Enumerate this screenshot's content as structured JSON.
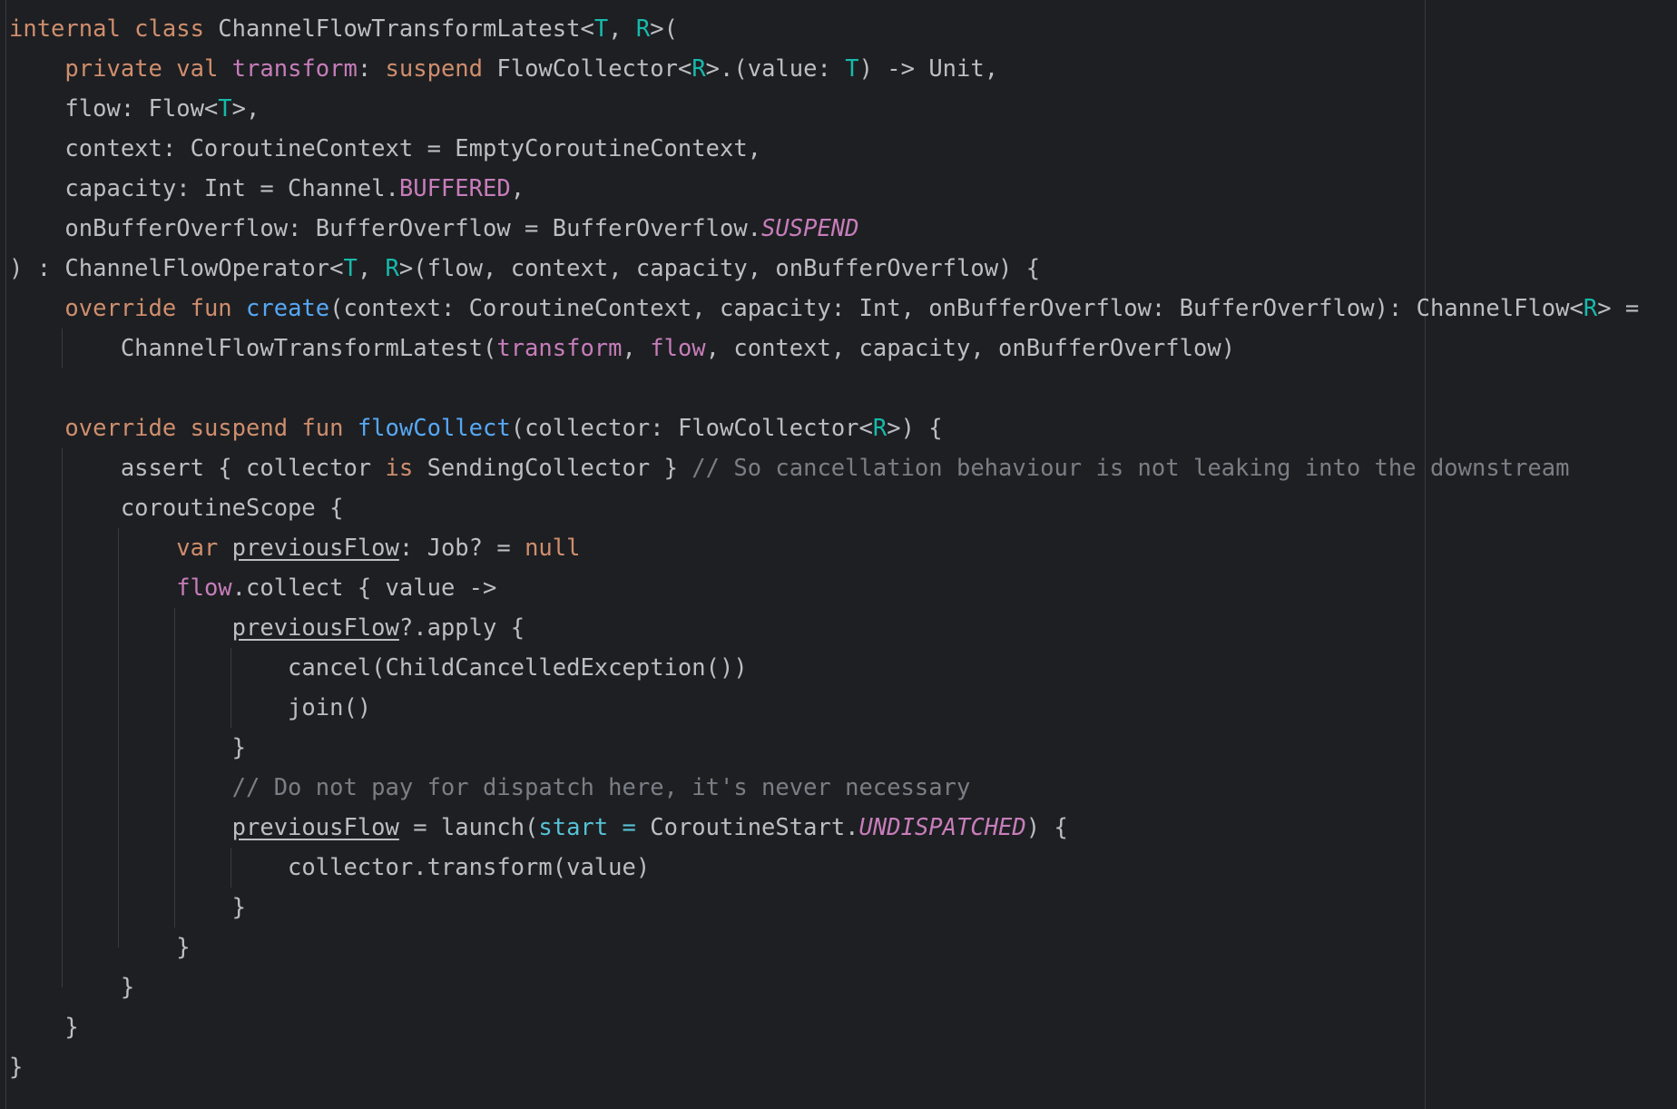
{
  "editor": {
    "theme": {
      "background": "#1e1f22",
      "default_text": "#bcbec4",
      "keyword": "#cf8e6d",
      "type_parameter": "#16baac",
      "property": "#c77dbb",
      "function_declaration": "#56a8f5",
      "comment": "#7a7e85",
      "named_argument": "#56c1d6",
      "guide": "#393b40"
    },
    "lines": [
      [
        [
          "kw",
          "internal class "
        ],
        [
          "txt",
          "ChannelFlowTransformLatest<"
        ],
        [
          "tp",
          "T"
        ],
        [
          "txt",
          ", "
        ],
        [
          "tp",
          "R"
        ],
        [
          "txt",
          ">("
        ]
      ],
      [
        [
          "txt",
          "    "
        ],
        [
          "kw",
          "private val "
        ],
        [
          "prop",
          "transform"
        ],
        [
          "txt",
          ": "
        ],
        [
          "kw",
          "suspend "
        ],
        [
          "txt",
          "FlowCollector<"
        ],
        [
          "tp",
          "R"
        ],
        [
          "txt",
          ">.(value: "
        ],
        [
          "tp",
          "T"
        ],
        [
          "txt",
          ") -> Unit,"
        ]
      ],
      [
        [
          "txt",
          "    flow: Flow<"
        ],
        [
          "tp",
          "T"
        ],
        [
          "txt",
          ">,"
        ]
      ],
      [
        [
          "txt",
          "    context: CoroutineContext = EmptyCoroutineContext,"
        ]
      ],
      [
        [
          "txt",
          "    capacity: Int = Channel."
        ],
        [
          "prop",
          "BUFFERED"
        ],
        [
          "txt",
          ","
        ]
      ],
      [
        [
          "txt",
          "    onBufferOverflow: BufferOverflow = BufferOverflow."
        ],
        [
          "cst",
          "SUSPEND"
        ]
      ],
      [
        [
          "txt",
          ") : ChannelFlowOperator<"
        ],
        [
          "tp",
          "T"
        ],
        [
          "txt",
          ", "
        ],
        [
          "tp",
          "R"
        ],
        [
          "txt",
          ">(flow, context, capacity, onBufferOverflow) {"
        ]
      ],
      [
        [
          "txt",
          "    "
        ],
        [
          "kw",
          "override fun "
        ],
        [
          "fn",
          "create"
        ],
        [
          "txt",
          "(context: CoroutineContext, capacity: Int, onBufferOverflow: BufferOverflow): ChannelFlow<"
        ],
        [
          "tp",
          "R"
        ],
        [
          "txt",
          "> ="
        ]
      ],
      [
        [
          "txt",
          "        ChannelFlowTransformLatest("
        ],
        [
          "prop",
          "transform"
        ],
        [
          "txt",
          ", "
        ],
        [
          "prop",
          "flow"
        ],
        [
          "txt",
          ", context, capacity, onBufferOverflow)"
        ]
      ],
      [
        [
          "txt",
          ""
        ]
      ],
      [
        [
          "txt",
          "    "
        ],
        [
          "kw",
          "override suspend fun "
        ],
        [
          "fn",
          "flowCollect"
        ],
        [
          "txt",
          "(collector: FlowCollector<"
        ],
        [
          "tp",
          "R"
        ],
        [
          "txt",
          ">) {"
        ]
      ],
      [
        [
          "txt",
          "        assert { collector "
        ],
        [
          "kw",
          "is "
        ],
        [
          "txt",
          "SendingCollector } "
        ],
        [
          "cm",
          "// So cancellation behaviour is not leaking into the downstream"
        ]
      ],
      [
        [
          "txt",
          "        coroutineScope {"
        ]
      ],
      [
        [
          "txt",
          "            "
        ],
        [
          "kw",
          "var "
        ],
        [
          "ul",
          "previousFlow"
        ],
        [
          "txt",
          ": Job? = "
        ],
        [
          "kw",
          "null"
        ]
      ],
      [
        [
          "txt",
          "            "
        ],
        [
          "prop",
          "flow"
        ],
        [
          "txt",
          ".collect { value ->"
        ]
      ],
      [
        [
          "txt",
          "                "
        ],
        [
          "ul",
          "previousFlow"
        ],
        [
          "txt",
          "?.apply {"
        ]
      ],
      [
        [
          "txt",
          "                    cancel(ChildCancelledException())"
        ]
      ],
      [
        [
          "txt",
          "                    join()"
        ]
      ],
      [
        [
          "txt",
          "                }"
        ]
      ],
      [
        [
          "txt",
          "                "
        ],
        [
          "cm",
          "// Do not pay for dispatch here, it's never necessary"
        ]
      ],
      [
        [
          "txt",
          "                "
        ],
        [
          "ul",
          "previousFlow"
        ],
        [
          "txt",
          " = launch("
        ],
        [
          "prm",
          "start = "
        ],
        [
          "txt",
          "CoroutineStart."
        ],
        [
          "cst",
          "UNDISPATCHED"
        ],
        [
          "txt",
          ") {"
        ]
      ],
      [
        [
          "txt",
          "                    collector.transform(value)"
        ]
      ],
      [
        [
          "txt",
          "                }"
        ]
      ],
      [
        [
          "txt",
          "            }"
        ]
      ],
      [
        [
          "txt",
          "        }"
        ]
      ],
      [
        [
          "txt",
          "    }"
        ]
      ],
      [
        [
          "txt",
          "}"
        ]
      ]
    ]
  }
}
